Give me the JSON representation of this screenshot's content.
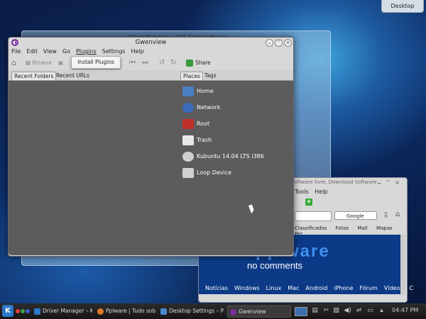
{
  "desktop": {
    "button_label": "Desktop"
  },
  "background_window": {
    "title": "Driver Manager – KDE Control Module"
  },
  "browser": {
    "title": "Software livre, Download Software...",
    "menu": [
      "Tools",
      "Help"
    ],
    "search_engine": "Google",
    "bookmarks": [
      "Classificados",
      "Fotos",
      "Mail",
      "Mapas",
      "Per"
    ],
    "logo": "pplware",
    "slogan": "no comments",
    "nav": [
      "Notícias",
      "Windows",
      "Linux",
      "Mac",
      "Android",
      "iPhone",
      "Fórum",
      "Vídeos",
      "C"
    ]
  },
  "gwenview": {
    "title": "Gwenview",
    "menu": [
      "File",
      "Edit",
      "View",
      "Go",
      "Plugins",
      "Settings",
      "Help"
    ],
    "toolbar": {
      "browse": "Browse",
      "share": "Share"
    },
    "plugins_menu": {
      "install": "Install Plugins"
    },
    "tabs_left": [
      "Recent Folders",
      "Recent URLs"
    ],
    "tabs_right": [
      "Places",
      "Tags"
    ],
    "places": [
      {
        "label": "Home",
        "color": "#4a7fc0"
      },
      {
        "label": "Network",
        "color": "#3a6ab8"
      },
      {
        "label": "Root",
        "color": "#c0302a"
      },
      {
        "label": "Trash",
        "color": "#e8e8e8"
      },
      {
        "label": "Kubuntu 14.04 LTS i386",
        "color": "#cfcfcf"
      },
      {
        "label": "Loop Device",
        "color": "#d0d0d0"
      }
    ]
  },
  "taskbar": {
    "tasks": [
      {
        "label": "Driver Manager – KDE",
        "color": "#2b79c9"
      },
      {
        "label": "Pplware | Tudo sobre",
        "color": "#e07a20"
      },
      {
        "label": "Desktop Settings – P",
        "color": "#4a8ad0"
      },
      {
        "label": "Gwenview",
        "color": "#7a2f9e"
      }
    ],
    "clock": "04:47 PM"
  }
}
